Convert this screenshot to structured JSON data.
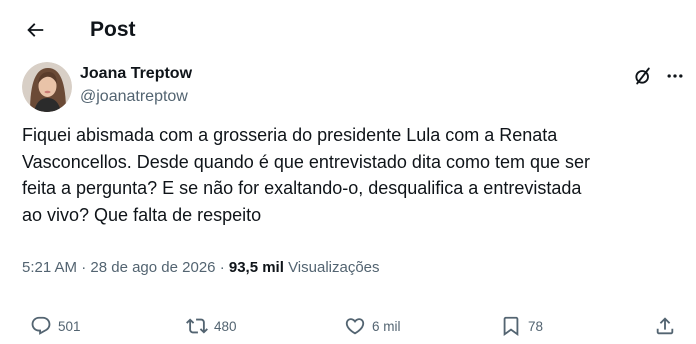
{
  "header": {
    "title": "Post"
  },
  "author": {
    "name": "Joana Treptow",
    "handle": "@joanatreptow"
  },
  "post": {
    "text": "Fiquei abismada com a grosseria do presidente Lula com a Renata\nVasconcellos. Desde quando é que entrevistado dita como tem que ser\nfeita a pergunta? E se não for exaltando-o, desqualifica a entrevistada\nao vivo? Que falta de respeito",
    "time": "5:21 AM",
    "separator": "·",
    "date": "28 de ago de 2026",
    "views_count": "93,5 mil",
    "views_label": "Visualizações"
  },
  "actions": {
    "replies": "501",
    "reposts": "480",
    "likes": "6 mil",
    "bookmarks": "78"
  },
  "icons": {
    "back": "arrow-left-icon",
    "grok": "grok-icon",
    "more": "more-horizontal-icon",
    "reply": "reply-icon",
    "repost": "repost-icon",
    "like": "heart-icon",
    "bookmark": "bookmark-icon",
    "share": "share-icon"
  },
  "colors": {
    "text": "#0f1419",
    "secondary": "#536471",
    "background": "#ffffff"
  }
}
